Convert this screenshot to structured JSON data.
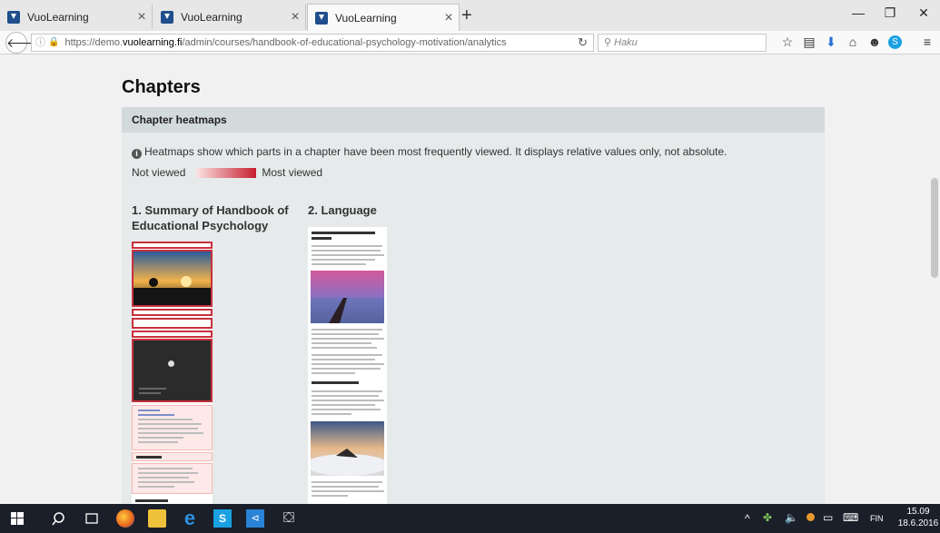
{
  "browser": {
    "tabs": [
      {
        "title": "VuoLearning",
        "active": false
      },
      {
        "title": "VuoLearning",
        "active": false
      },
      {
        "title": "VuoLearning",
        "active": true
      }
    ],
    "url_prefix": "https://demo.",
    "url_host": "vuolearning.fi",
    "url_path": "/admin/courses/handbook-of-educational-psychology-motivation/analytics",
    "search_placeholder": "Haku"
  },
  "page": {
    "title": "Chapters",
    "panel_title": "Chapter heatmaps",
    "info_text": "Heatmaps show which parts in a chapter have been most frequently viewed. It displays relative values only, not absolute.",
    "legend_min": "Not viewed",
    "legend_max": "Most viewed",
    "legend_colors": [
      "#fbe3e3",
      "#c61e2d"
    ],
    "chapters": [
      {
        "title": "1. Summary of Handbook of Educational Psychology"
      },
      {
        "title": "2. Language"
      }
    ]
  },
  "taskbar": {
    "time": "15.09",
    "date": "18.6.2016",
    "language": "FIN"
  }
}
